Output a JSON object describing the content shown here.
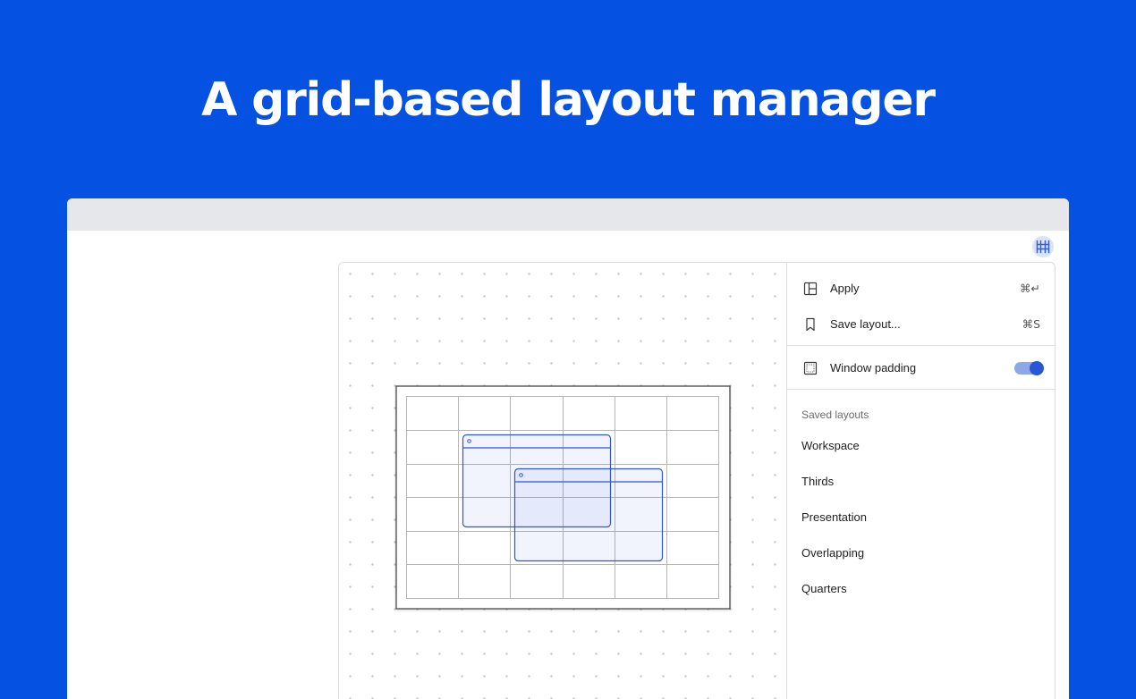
{
  "headline": "A grid-based layout manager",
  "menu": {
    "apply_label": "Apply",
    "apply_shortcut": "⌘↵",
    "save_label": "Save layout...",
    "save_shortcut": "⌘S",
    "padding_label": "Window padding",
    "padding_enabled": true
  },
  "saved_layouts": {
    "heading": "Saved layouts",
    "items": [
      "Workspace",
      "Thirds",
      "Presentation",
      "Overlapping",
      "Quarters"
    ]
  },
  "colors": {
    "background": "#0551e2",
    "accent": "#2856d6",
    "toggle_track": "#8ea7e9"
  },
  "icons": {
    "menubar": "grid-icon",
    "apply": "layout-panels-icon",
    "save": "bookmark-icon",
    "padding": "window-padding-icon"
  }
}
